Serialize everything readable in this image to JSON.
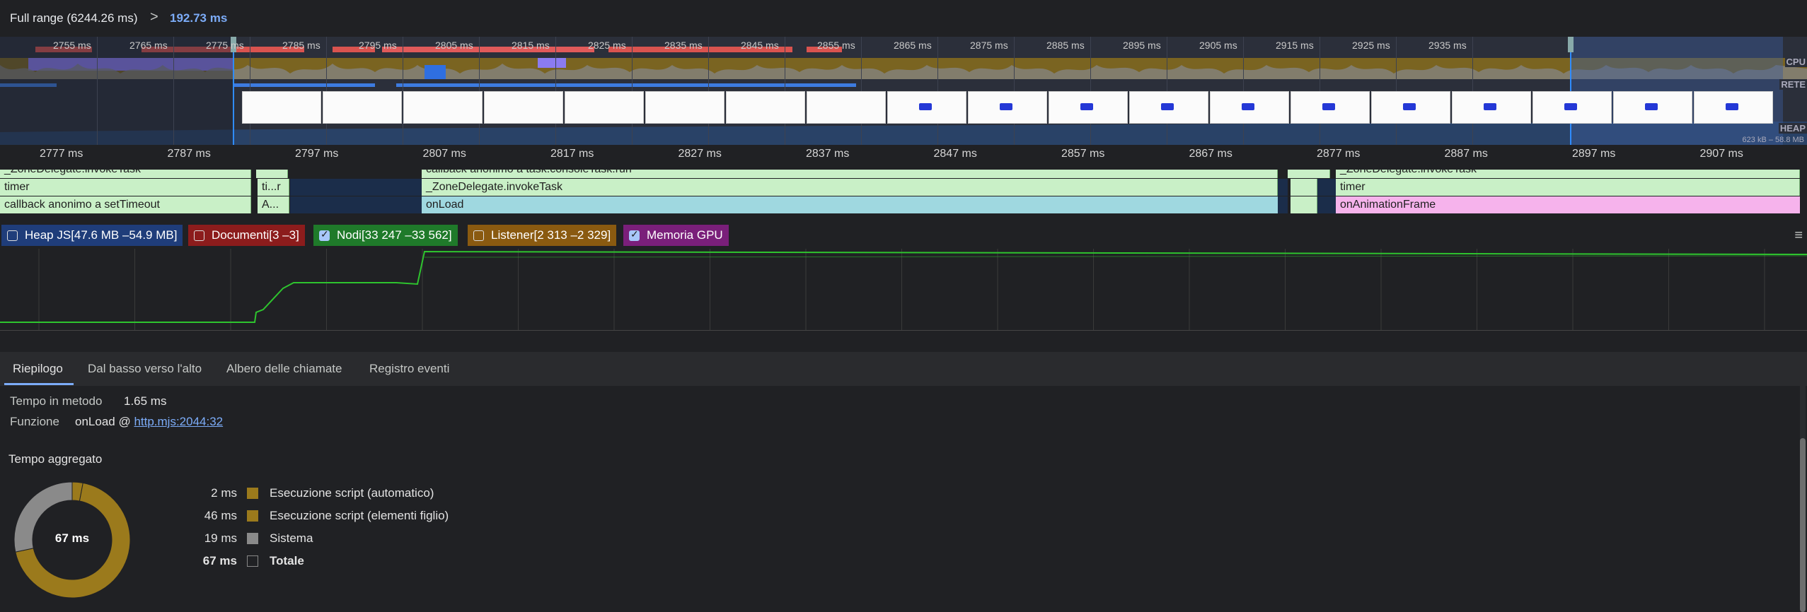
{
  "range": {
    "full_label": "Full range (6244.26 ms)",
    "chevron": ">",
    "selection": "192.73 ms"
  },
  "overview": {
    "ticks": [
      "2755 ms",
      "2765 ms",
      "2775 ms",
      "2785 ms",
      "2795 ms",
      "2805 ms",
      "2815 ms",
      "2825 ms",
      "2835 ms",
      "2845 ms",
      "2855 ms",
      "2865 ms",
      "2875 ms",
      "2885 ms",
      "2895 ms",
      "2905 ms",
      "2915 ms",
      "2925 ms",
      "2935 ms"
    ],
    "lane_cpu": "CPU",
    "lane_net": "RETE",
    "lane_heap": "HEAP",
    "heap_range": "623 kB – 58.8 MB"
  },
  "ruler": {
    "ticks": [
      "2777 ms",
      "2787 ms",
      "2797 ms",
      "2807 ms",
      "2817 ms",
      "2827 ms",
      "2837 ms",
      "2847 ms",
      "2857 ms",
      "2867 ms",
      "2877 ms",
      "2887 ms",
      "2897 ms",
      "2907 ms"
    ]
  },
  "flame": {
    "row0": [
      "_ZoneDelegate.invokeTask",
      "_ZoneDelegate.invokeTask",
      "callback anonimo a task.consoleTask.run",
      "_ZoneDelegate.invokeTask"
    ],
    "row1_left": "timer",
    "row1_small": "ti...r",
    "row1_mid": "_ZoneDelegate.invokeTask",
    "row1_right": "timer",
    "row2_left": "callback anonimo a setTimeout",
    "row2_small": "A...",
    "row2_mid": "onLoad",
    "row2_right": "onAnimationFrame"
  },
  "counters": [
    {
      "label": "Heap JS[47.6 MB –54.9 MB]",
      "checked": false,
      "color": "#1f3d7a"
    },
    {
      "label": "Documenti[3 –3]",
      "checked": false,
      "color": "#8c1c1c"
    },
    {
      "label": "Nodi[33 247 –33 562]",
      "checked": true,
      "color": "#1f7a2a"
    },
    {
      "label": "Listener[2 313 –2 329]",
      "checked": false,
      "color": "#8a5a10"
    },
    {
      "label": "Memoria GPU",
      "checked": true,
      "color": "#7a1f7a"
    }
  ],
  "tabs": [
    "Riepilogo",
    "Dal basso verso l'alto",
    "Albero delle chiamate",
    "Registro eventi"
  ],
  "summary": {
    "self_time_label": "Tempo in metodo",
    "self_time_value": "1.65 ms",
    "function_label": "Funzione",
    "function_name": "onLoad @ ",
    "function_link": "http.mjs:2044:32",
    "aggregated_title": "Tempo aggregato",
    "donut_total": "67 ms"
  },
  "chart_data": {
    "type": "pie",
    "title": "Tempo aggregato",
    "categories": [
      "Esecuzione script (automatico)",
      "Esecuzione script (elementi figlio)",
      "Sistema"
    ],
    "values": [
      2,
      46,
      19
    ],
    "value_labels": [
      "2 ms",
      "46 ms",
      "19 ms"
    ],
    "colors": [
      "#9b7a1c",
      "#9b7a1c",
      "#8a8a8a"
    ],
    "total_label": "Totale",
    "total_value": "67 ms"
  }
}
